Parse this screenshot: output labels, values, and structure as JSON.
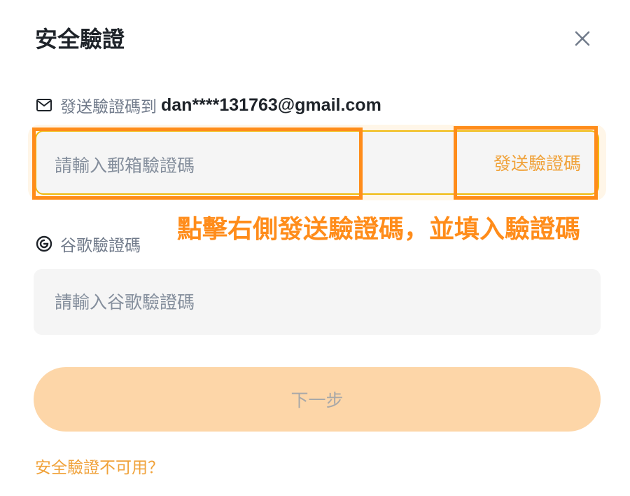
{
  "dialog": {
    "title": "安全驗證",
    "close_icon": "close-icon"
  },
  "email_section": {
    "label_prefix": "發送驗證碼到",
    "email": "dan****131763@gmail.com",
    "input_placeholder": "請輸入郵箱驗證碼",
    "input_value": "",
    "send_code_label": "發送驗證碼",
    "icon": "mail-icon"
  },
  "annotation": {
    "text": "點擊右側發送驗證碼，並填入驗證碼",
    "color": "#ff8c1a"
  },
  "google_section": {
    "label": "谷歌驗證碼",
    "input_placeholder": "請輸入谷歌驗證碼",
    "input_value": "",
    "icon": "google-authenticator-icon"
  },
  "actions": {
    "next_label": "下一步",
    "unavailable_link": "安全驗證不可用？"
  },
  "colors": {
    "accent": "#f0a23a",
    "focus_border": "#f0b90b",
    "disabled_button_bg": "#fdd6a8",
    "field_bg": "#f5f5f5"
  }
}
